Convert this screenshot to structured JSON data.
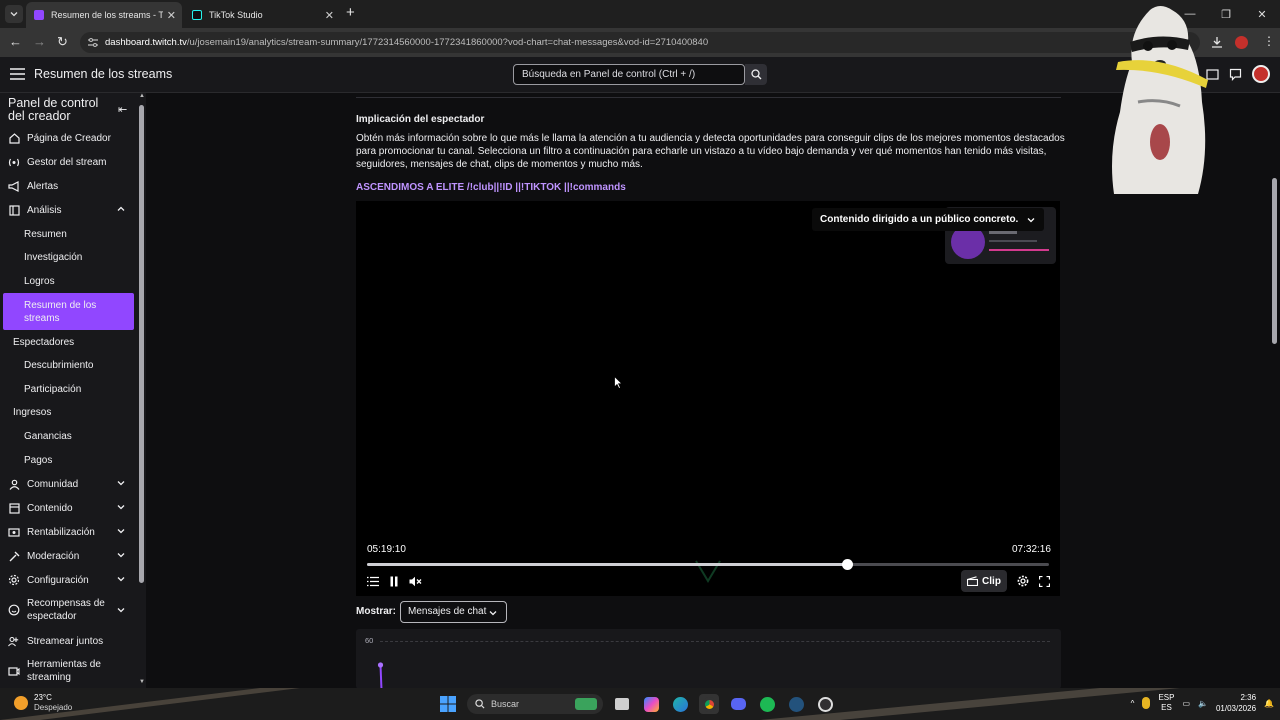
{
  "browser": {
    "tabs": [
      {
        "label": "Resumen de los streams - Twitc",
        "active": true
      },
      {
        "label": "TikTok Studio",
        "active": false
      }
    ],
    "new_tab_symbol": "+",
    "url_host": "dashboard.twitch.tv",
    "url_path": "/u/josemain19/analytics/stream-summary/1772314560000-1772341860000?vod-chart=chat-messages&vod-id=2710400840"
  },
  "topbar": {
    "title": "Resumen de los streams",
    "search_placeholder": "Búsqueda en Panel de control (Ctrl + /)"
  },
  "sidebar": {
    "title": "Panel de control del creador",
    "items": [
      {
        "label": "Página de Creador",
        "icon": "home-icon"
      },
      {
        "label": "Gestor del stream",
        "icon": "broadcast-icon"
      },
      {
        "label": "Alertas",
        "icon": "megaphone-icon"
      },
      {
        "label": "Análisis",
        "icon": "analytics-icon"
      }
    ],
    "analytics_sub": [
      "Resumen",
      "Investigación",
      "Logros",
      "Resumen de los streams"
    ],
    "group_viewers": "Espectadores",
    "viewers_sub": [
      "Descubrimiento",
      "Participación"
    ],
    "group_revenue": "Ingresos",
    "revenue_sub": [
      "Ganancias",
      "Pagos"
    ],
    "bottom_items": [
      {
        "label": "Comunidad",
        "icon": "community-icon",
        "chevron": true
      },
      {
        "label": "Contenido",
        "icon": "content-icon",
        "chevron": true
      },
      {
        "label": "Rentabilización",
        "icon": "monetization-icon",
        "chevron": true
      },
      {
        "label": "Moderación",
        "icon": "moderation-icon",
        "chevron": true
      },
      {
        "label": "Configuración",
        "icon": "settings-icon",
        "chevron": true
      },
      {
        "label": "Recompensas de espectador",
        "icon": "rewards-icon",
        "chevron": true
      },
      {
        "label": "Streamear juntos",
        "icon": "collab-icon",
        "chevron": false
      },
      {
        "label": "Herramientas de streaming",
        "icon": "tools-icon",
        "chevron": false
      }
    ]
  },
  "main": {
    "section_title": "Implicación del espectador",
    "section_desc": "Obtén más información sobre lo que más le llama la atención a tu audiencia y detecta oportunidades para conseguir clips de los mejores momentos destacados para promocionar tu canal. Selecciona un filtro a continuación para echarle un vistazo a tu vídeo bajo demanda y ver qué momentos han tenido más visitas, seguidores, mensajes de chat, clips de momentos y mucho más.",
    "stream_title": "ASCENDIMOS A ELITE /!club||!ID ||!TIKTOK ||!commands",
    "player": {
      "content_warning": "Contenido dirigido a un público concreto.",
      "time_current": "05:19:10",
      "time_total": "07:32:16",
      "progress_fraction": 0.705,
      "clip_label": "Clip"
    },
    "show_label": "Mostrar:",
    "show_value": "Mensajes de chat",
    "chart_tick_top": "60"
  },
  "taskbar": {
    "temperature": "23°C",
    "weather": "Despejado",
    "search_label": "Buscar",
    "lang_top": "ESP",
    "lang_bottom": "ES",
    "time": "2:36",
    "date": "01/03/2026"
  },
  "colors": {
    "twitch_purple": "#9147ff",
    "link_purple": "#bf94ff",
    "bg_dark": "#0e0e10",
    "panel": "#18181b"
  }
}
